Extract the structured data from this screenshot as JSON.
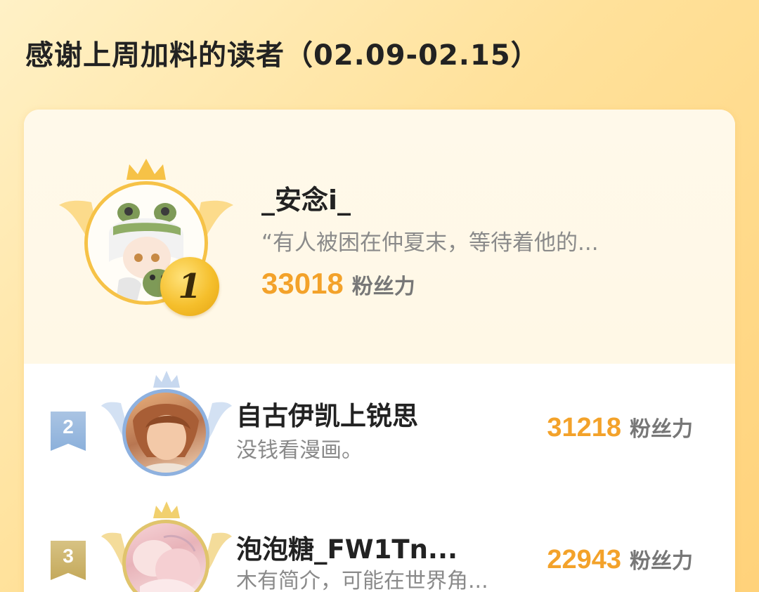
{
  "title": "感谢上周加料的读者（02.09-02.15）",
  "colors": {
    "accent_score": "#f3a22a",
    "gold": "#f6c247",
    "silver_blue": "#8eb1df",
    "bronze": "#c4a95b"
  },
  "ranking": [
    {
      "rank": "1",
      "name": "_安念i_",
      "description": "“有人被困在仲夏末，等待着他的...",
      "score": "33018",
      "unit": "粉丝力"
    },
    {
      "rank": "2",
      "name": "自古伊凯上锐思",
      "description": "没钱看漫画。",
      "score": "31218",
      "unit": "粉丝力"
    },
    {
      "rank": "3",
      "name": "泡泡糖_FW1Tn...",
      "description": "木有简介，可能在世界角...",
      "score": "22943",
      "unit": "粉丝力"
    }
  ]
}
